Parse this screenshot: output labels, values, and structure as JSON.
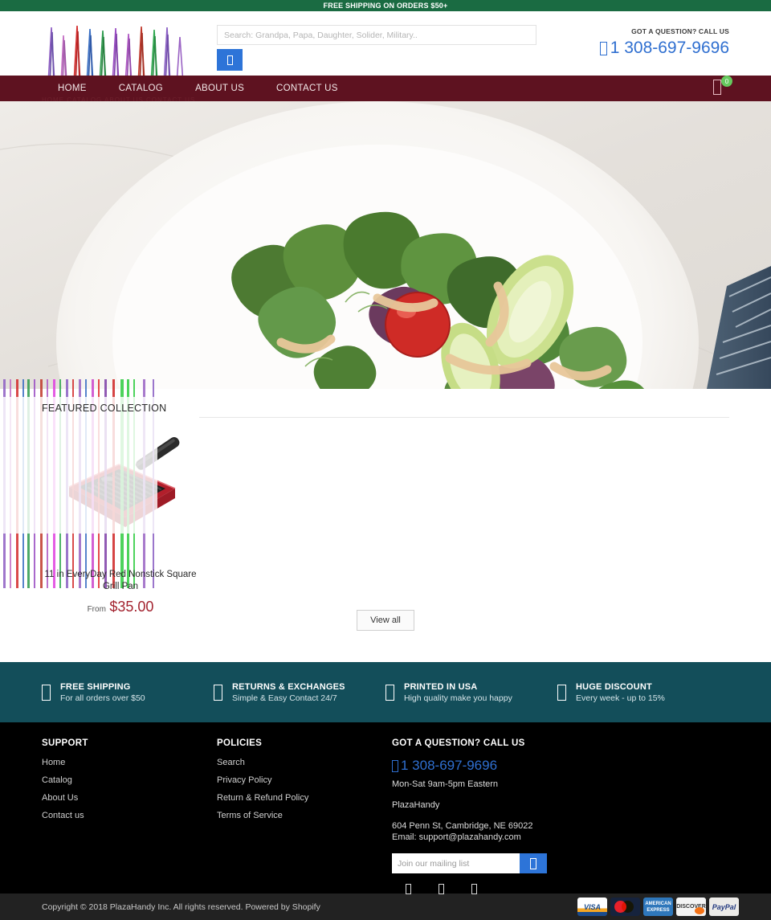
{
  "announcement": {
    "text": "FREE SHIPPING ON ORDERS $50+"
  },
  "header": {
    "logo_alt": "PlazaHandy logo",
    "search": {
      "placeholder": "Search: Grandpa, Papa, Daughter, Solider, Military..",
      "value": "",
      "button_icon": "search-icon",
      "button_glyph": "□"
    },
    "call_us": {
      "label": "GOT A QUESTION? CALL US",
      "phone": "1 308-697-9696",
      "icon": "phone-icon"
    }
  },
  "nav": {
    "items": [
      {
        "label": "HOME"
      },
      {
        "label": "CATALOG"
      },
      {
        "label": "ABOUT US"
      },
      {
        "label": "CONTACT US"
      }
    ],
    "subtext": "HOME CATALOG ABOUT US CONTACT US",
    "cart": {
      "icon": "cart-icon",
      "count": "0"
    }
  },
  "hero": {
    "alt": "Fresh green salad with cherry tomatoes, cucumber and dressing on a white plate"
  },
  "featured": {
    "title": "FEATURED COLLECTION",
    "products": [
      {
        "name": "11 in EveryDay Red Nonstick Square Grill Pan",
        "price_prefix": "From",
        "price": "$35.00",
        "image_alt": "Red nonstick square grill pan"
      }
    ],
    "view_all_label": "View all"
  },
  "features_bar": {
    "items": [
      {
        "icon": "truck-icon",
        "title": "FREE SHIPPING",
        "subtitle": "For all orders over $50"
      },
      {
        "icon": "refresh-icon",
        "title": "RETURNS & EXCHANGES",
        "subtitle": "Simple & Easy Contact 24/7"
      },
      {
        "icon": "flag-icon",
        "title": "PRINTED IN USA",
        "subtitle": "High quality make you happy"
      },
      {
        "icon": "tag-icon",
        "title": "HUGE DISCOUNT",
        "subtitle": "Every week - up to 15%"
      }
    ]
  },
  "footer": {
    "support": {
      "title": "SUPPORT",
      "links": [
        {
          "label": "Home"
        },
        {
          "label": "Catalog"
        },
        {
          "label": "About Us"
        },
        {
          "label": "Contact us"
        }
      ]
    },
    "policies": {
      "title": "POLICIES",
      "links": [
        {
          "label": "Search"
        },
        {
          "label": "Privacy Policy"
        },
        {
          "label": "Return & Refund Policy"
        },
        {
          "label": "Terms of Service"
        }
      ]
    },
    "contact": {
      "title": "GOT A QUESTION? CALL US",
      "phone": "1 308-697-9696",
      "phone_icon": "phone-icon",
      "hours": "Mon-Sat 9am-5pm Eastern",
      "brand": "PlazaHandy",
      "address": "604 Penn St, Cambridge, NE 69022",
      "email": "Email: support@plazahandy.com",
      "newsletter": {
        "placeholder": "Join our mailing list",
        "value": "",
        "button_icon": "send-icon"
      },
      "social": [
        {
          "icon": "facebook-icon"
        },
        {
          "icon": "twitter-icon"
        },
        {
          "icon": "instagram-icon"
        }
      ]
    }
  },
  "copyright": {
    "text": "Copyright © 2018 PlazaHandy Inc. All rights reserved. Powered by Shopify",
    "payments": [
      {
        "name": "VISA"
      },
      {
        "name": "MasterCard"
      },
      {
        "name": "AMERICAN EXPRESS"
      },
      {
        "name": "DISCOVER"
      },
      {
        "name": "PayPal"
      }
    ]
  },
  "colors": {
    "announce_green": "#1a6b42",
    "nav_maroon": "#5e1220",
    "accent_blue": "#2d74d8",
    "features_teal": "#134e5a",
    "price_red": "#a3232f",
    "badge_green": "#66c95e"
  }
}
